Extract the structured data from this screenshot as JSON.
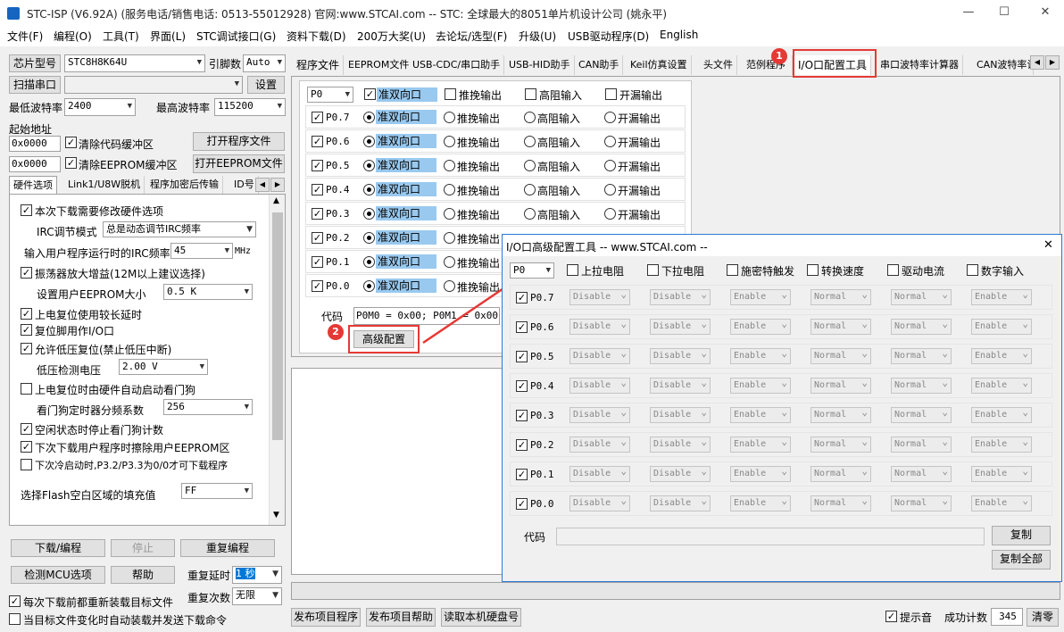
{
  "window": {
    "title": "STC-ISP (V6.92A) (服务电话/销售电话: 0513-55012928) 官网:www.STCAI.com  -- STC: 全球最大的8051单片机设计公司 (姚永平)",
    "min": "—",
    "max": "☐",
    "close": "✕"
  },
  "menu": [
    "文件(F)",
    "编程(O)",
    "工具(T)",
    "界面(L)",
    "STC调试接口(G)",
    "资料下载(D)",
    "200万大奖(U)",
    "去论坛/选型(F)",
    "升级(U)",
    "USB驱动程序(D)",
    "English"
  ],
  "left": {
    "chip_label": "芯片型号",
    "chip_value": "STC8H8K64U",
    "pin_label": "引脚数",
    "pin_value": "Auto",
    "scan_button": "扫描串口",
    "settings_button": "设置",
    "min_baud_label": "最低波特率",
    "min_baud_value": "2400",
    "max_baud_label": "最高波特率",
    "max_baud_value": "115200",
    "start_addr_label": "起始地址",
    "addr1": "0x0000",
    "clear_code": "清除代码缓冲区",
    "open_prog": "打开程序文件",
    "addr2": "0x0000",
    "clear_eeprom": "清除EEPROM缓冲区",
    "open_eeprom": "打开EEPROM文件",
    "tabs": [
      "硬件选项",
      "Link1/U8W脱机",
      "程序加密后传输",
      "ID号"
    ],
    "hw_opts": {
      "modify_hw": "本次下载需要修改硬件选项",
      "irc_mode_label": "IRC调节模式",
      "irc_mode_value": "总是动态调节IRC频率",
      "irc_freq_label": "输入用户程序运行时的IRC频率",
      "irc_freq_value": "45",
      "irc_unit": "MHz",
      "osc_gain": "振荡器放大增益(12M以上建议选择)",
      "eeprom_size_label": "设置用户EEPROM大小",
      "eeprom_size_value": "0.5 K",
      "long_reset": "上电复位使用较长延时",
      "reset_io": "复位脚用作I/O口",
      "lvr": "允许低压复位(禁止低压中断)",
      "lv_label": "低压检测电压",
      "lv_value": "2.00 V",
      "wdt_auto": "上电复位时由硬件自动启动看门狗",
      "wdt_div_label": "看门狗定时器分频系数",
      "wdt_div_value": "256",
      "idle_wdt": "空闲状态时停止看门狗计数",
      "erase_eeprom": "下次下载用户程序时擦除用户EEPROM区",
      "p32p33": "下次冷启动时,P3.2/P3.3为0/0才可下载程序",
      "flash_fill_label": "选择Flash空白区域的填充值",
      "flash_fill_value": "FF"
    },
    "download_button": "下载/编程",
    "stop_button": "停止",
    "reprogram_button": "重复编程",
    "detect_button": "检测MCU选项",
    "help_button": "帮助",
    "repeat_delay_label": "重复延时",
    "repeat_delay_value": "1 秒",
    "repeat_count_label": "重复次数",
    "repeat_count_value": "无限",
    "reload_each": "每次下载前都重新装载目标文件",
    "auto_send": "当目标文件变化时自动装载并发送下载命令"
  },
  "right_tabs": [
    "程序文件",
    "EEPROM文件",
    "USB-CDC/串口助手",
    "USB-HID助手",
    "CAN助手",
    "Keil仿真设置",
    "头文件",
    "范例程序",
    "I/O口配置工具",
    "串口波特率计算器",
    "CAN波特率计"
  ],
  "io": {
    "port_select": "P0",
    "header_modes": [
      "准双向口",
      "推挽输出",
      "高阻输入",
      "开漏输出"
    ],
    "pins": [
      "P0.7",
      "P0.6",
      "P0.5",
      "P0.4",
      "P0.3",
      "P0.2",
      "P0.1",
      "P0.0"
    ],
    "code_label": "代码",
    "code_value": "P0M0 = 0x00; P0M1 = 0x00;",
    "advanced_button": "高级配置"
  },
  "badges": [
    "1",
    "2"
  ],
  "dialog": {
    "title": "I/O口高级配置工具 -- www.STCAI.com --",
    "close": "✕",
    "port_select": "P0",
    "headers": [
      "上拉电阻",
      "下拉电阻",
      "施密特触发",
      "转换速度",
      "驱动电流",
      "数字输入"
    ],
    "pins": [
      "P0.7",
      "P0.6",
      "P0.5",
      "P0.4",
      "P0.3",
      "P0.2",
      "P0.1",
      "P0.0"
    ],
    "cells": [
      "Disable",
      "Disable",
      "Enable",
      "Normal",
      "Normal",
      "Enable"
    ],
    "code_label": "代码",
    "copy_button": "复制",
    "copy_all_button": "复制全部"
  },
  "bottom": {
    "publish_prog": "发布项目程序",
    "publish_help": "发布项目帮助",
    "read_disk": "读取本机硬盘号",
    "beep": "提示音",
    "success_label": "成功计数",
    "success_value": "345",
    "clear_button": "清零"
  }
}
